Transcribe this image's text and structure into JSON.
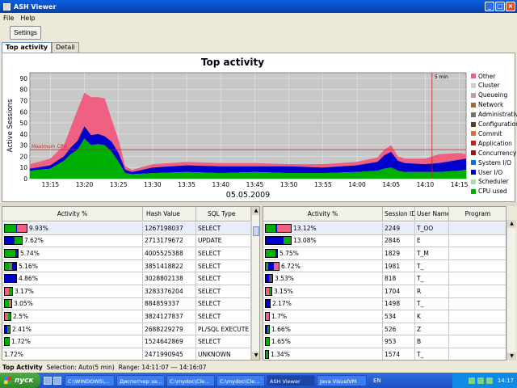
{
  "window": {
    "title": "ASH Viewer",
    "btn_min": "_",
    "btn_max": "□",
    "btn_close": "×"
  },
  "menu": [
    "File",
    "Help"
  ],
  "toolbar": {
    "settings_label": "Settings"
  },
  "tabs": [
    {
      "label": "Top activity",
      "active": true
    },
    {
      "label": "Detail",
      "active": false
    }
  ],
  "chart_data": {
    "type": "area",
    "title": "Top activity",
    "ylabel": "Active Sessions",
    "xlabel": "05.05.2009",
    "ylim": [
      0,
      95
    ],
    "yticks": [
      0,
      10,
      20,
      30,
      40,
      50,
      60,
      70,
      80,
      90
    ],
    "x_ticks": [
      "13:15",
      "13:20",
      "13:25",
      "13:30",
      "13:35",
      "13:40",
      "13:45",
      "13:50",
      "13:55",
      "14:00",
      "14:05",
      "14:10",
      "14:15"
    ],
    "x_range": [
      "13:12",
      "14:16"
    ],
    "max_cpu": {
      "label": "Maximum CPU",
      "value": 26
    },
    "window_marker": {
      "label": "5 min",
      "x": "14:11"
    },
    "x": [
      "13:12",
      "13:15",
      "13:17",
      "13:18",
      "13:19",
      "13:20",
      "13:21",
      "13:22",
      "13:23",
      "13:24",
      "13:25",
      "13:26",
      "13:27",
      "13:30",
      "13:35",
      "13:40",
      "13:45",
      "13:50",
      "13:55",
      "14:00",
      "14:03",
      "14:04",
      "14:05",
      "14:06",
      "14:07",
      "14:10",
      "14:12",
      "14:15",
      "14:16"
    ],
    "series": [
      {
        "name": "CPU used",
        "color": "#00b000",
        "values": [
          7,
          9,
          16,
          22,
          26,
          36,
          30,
          31,
          30,
          24,
          15,
          5,
          4,
          5,
          6,
          5,
          6,
          5,
          5,
          6,
          7,
          9,
          10,
          7,
          6,
          6,
          6,
          7,
          8
        ]
      },
      {
        "name": "User I/O",
        "color": "#0000cc",
        "values": [
          2,
          3,
          4,
          6,
          8,
          11,
          9,
          9,
          8,
          9,
          8,
          3,
          2,
          5,
          6,
          6,
          5,
          6,
          5,
          6,
          8,
          12,
          14,
          9,
          8,
          7,
          8,
          10,
          10
        ]
      },
      {
        "name": "Other",
        "color": "#f06080",
        "values": [
          4,
          6,
          10,
          18,
          28,
          30,
          34,
          33,
          34,
          20,
          12,
          3,
          2,
          3,
          3,
          3,
          3,
          2,
          3,
          3,
          4,
          5,
          6,
          4,
          4,
          5,
          8,
          6,
          4
        ]
      }
    ],
    "legend": [
      "Other",
      "Cluster",
      "Queueing",
      "Network",
      "Administrative",
      "Configuration",
      "Commit",
      "Application",
      "Concurrency",
      "System I/O",
      "User I/O",
      "Scheduler",
      "CPU used"
    ],
    "legend_colors": [
      "#f06080",
      "#cfcfcf",
      "#b8a0a0",
      "#9a6a3a",
      "#727272",
      "#5b3a1e",
      "#d07040",
      "#c02020",
      "#8b1a1a",
      "#1070d0",
      "#0000cc",
      "#a0e0a0",
      "#00b000"
    ]
  },
  "left_table": {
    "headers": [
      "Activity %",
      "Hash Value",
      "SQL Type"
    ],
    "rows": [
      {
        "pct": "9.93%",
        "hash": "1267198037",
        "type": "SELECT",
        "bar": [
          {
            "c": "#00b000",
            "w": 14
          },
          {
            "c": "#0000cc",
            "w": 1
          },
          {
            "c": "#f06080",
            "w": 12
          }
        ]
      },
      {
        "pct": "7.62%",
        "hash": "2713179672",
        "type": "UPDATE",
        "bar": [
          {
            "c": "#0000cc",
            "w": 12
          },
          {
            "c": "#00b000",
            "w": 9
          }
        ]
      },
      {
        "pct": "5.74%",
        "hash": "4005525388",
        "type": "SELECT",
        "bar": [
          {
            "c": "#00b000",
            "w": 13
          },
          {
            "c": "#0000cc",
            "w": 3
          }
        ]
      },
      {
        "pct": "5.16%",
        "hash": "3851418822",
        "type": "SELECT",
        "bar": [
          {
            "c": "#00b000",
            "w": 5
          },
          {
            "c": "#777",
            "w": 4
          },
          {
            "c": "#0000cc",
            "w": 5
          }
        ]
      },
      {
        "pct": "4.86%",
        "hash": "3028802138",
        "type": "SELECT",
        "bar": [
          {
            "c": "#0000cc",
            "w": 14
          }
        ]
      },
      {
        "pct": "3.17%",
        "hash": "3283376204",
        "type": "SELECT",
        "bar": [
          {
            "c": "#f06080",
            "w": 5
          },
          {
            "c": "#00b000",
            "w": 4
          }
        ]
      },
      {
        "pct": "3.05%",
        "hash": "884859337",
        "type": "SELECT",
        "bar": [
          {
            "c": "#00b000",
            "w": 5
          },
          {
            "c": "#f06080",
            "w": 3
          }
        ]
      },
      {
        "pct": "2.5%",
        "hash": "3824127837",
        "type": "SELECT",
        "bar": [
          {
            "c": "#f06080",
            "w": 4
          },
          {
            "c": "#00b000",
            "w": 3
          }
        ]
      },
      {
        "pct": "2.41%",
        "hash": "2688229279",
        "type": "PL/SQL EXECUTE",
        "bar": [
          {
            "c": "#0000cc",
            "w": 3
          },
          {
            "c": "#00b000",
            "w": 3
          }
        ]
      },
      {
        "pct": "1.72%",
        "hash": "1524642869",
        "type": "SELECT",
        "bar": [
          {
            "c": "#00b000",
            "w": 5
          }
        ]
      },
      {
        "pct": "1.72%",
        "hash": "2471990945",
        "type": "UNKNOWN",
        "bar": []
      }
    ]
  },
  "right_table": {
    "headers": [
      "Activity %",
      "Session ID",
      "User Name",
      "Program"
    ],
    "rows": [
      {
        "pct": "13.12%",
        "sid": "2249",
        "user": "T_OO",
        "bar": [
          {
            "c": "#00b000",
            "w": 12
          },
          {
            "c": "#0000cc",
            "w": 2
          },
          {
            "c": "#f06080",
            "w": 17
          }
        ]
      },
      {
        "pct": "13.08%",
        "sid": "2846",
        "user": "E",
        "bar": [
          {
            "c": "#0000cc",
            "w": 22
          },
          {
            "c": "#00b000",
            "w": 9
          }
        ]
      },
      {
        "pct": "5.75%",
        "sid": "1829",
        "user": "T_M",
        "bar": [
          {
            "c": "#00b000",
            "w": 12
          },
          {
            "c": "#0000cc",
            "w": 2
          }
        ]
      },
      {
        "pct": "6.72%",
        "sid": "1981",
        "user": "T_",
        "bar": [
          {
            "c": "#00b000",
            "w": 3
          },
          {
            "c": "#0000cc",
            "w": 7
          },
          {
            "c": "#f06080",
            "w": 6
          }
        ]
      },
      {
        "pct": "3.53%",
        "sid": "818",
        "user": "T_",
        "bar": [
          {
            "c": "#0000cc",
            "w": 4
          },
          {
            "c": "#555",
            "w": 4
          }
        ]
      },
      {
        "pct": "3.15%",
        "sid": "1704",
        "user": "R",
        "bar": [
          {
            "c": "#f06080",
            "w": 4
          },
          {
            "c": "#00b000",
            "w": 3
          }
        ]
      },
      {
        "pct": "2.17%",
        "sid": "1498",
        "user": "T_",
        "bar": [
          {
            "c": "#0000cc",
            "w": 5
          }
        ]
      },
      {
        "pct": "1.7%",
        "sid": "534",
        "user": "K",
        "bar": [
          {
            "c": "#f06080",
            "w": 4
          }
        ]
      },
      {
        "pct": "1.66%",
        "sid": "526",
        "user": "Z",
        "bar": [
          {
            "c": "#0000cc",
            "w": 2
          },
          {
            "c": "#00b000",
            "w": 2
          }
        ]
      },
      {
        "pct": "1.65%",
        "sid": "953",
        "user": "B",
        "bar": [
          {
            "c": "#00b000",
            "w": 4
          }
        ]
      },
      {
        "pct": "1.34%",
        "sid": "1574",
        "user": "T_",
        "bar": [
          {
            "c": "#00b000",
            "w": 3
          }
        ]
      }
    ]
  },
  "status": {
    "view": "Top Activity",
    "selection": "Selection: Auto(5 min)",
    "range": "Range: 14:11:07 --- 14:16:07"
  },
  "taskbar": {
    "start_label": "пуск",
    "tasks": [
      {
        "label": "C:\\WINDOWS\\...",
        "active": false
      },
      {
        "label": "Диспетчер за...",
        "active": false
      },
      {
        "label": "C:\\mydoc\\Cle...",
        "active": false
      },
      {
        "label": "C:\\mydoc\\Cle...",
        "active": false
      },
      {
        "label": "ASH Viewer",
        "active": true
      },
      {
        "label": "Java VisualVM",
        "active": false
      }
    ],
    "lang": "EN",
    "clock": "14:17"
  }
}
